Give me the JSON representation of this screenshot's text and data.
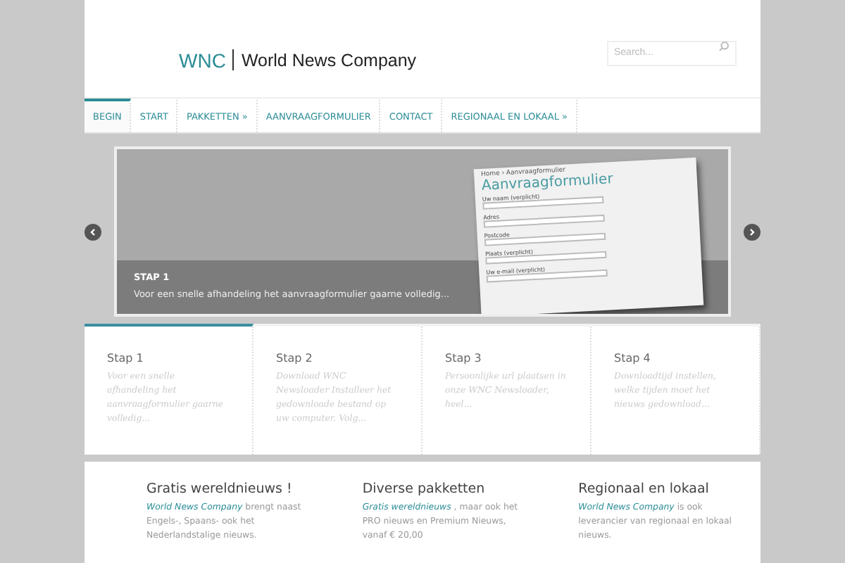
{
  "header": {
    "logo_short": "WNC",
    "logo_name": "World News Company",
    "search": {
      "placeholder": "Search..."
    }
  },
  "nav": [
    {
      "label": "BEGIN",
      "selected": true
    },
    {
      "label": "START",
      "selected": false
    },
    {
      "label": "PAKKETTEN »",
      "selected": false
    },
    {
      "label": "AANVRAAGFORMULIER",
      "selected": false
    },
    {
      "label": "CONTACT",
      "selected": false
    },
    {
      "label": "REGIONAAL EN LOKAAL »",
      "selected": false
    }
  ],
  "slider": {
    "form_image": {
      "breadcrumb": "Home › Aanvraagformulier",
      "title": "Aanvraagformulier",
      "fields": [
        "Uw naam (verplicht)",
        "Adres",
        "Postcode",
        "Plaats (verplicht)",
        "Uw e-mail (verplicht)"
      ]
    },
    "caption_title": "STAP 1",
    "caption_text": "Voor een snelle afhandeling het aanvraagformulier gaarne volledig..."
  },
  "steps": [
    {
      "title": "Stap 1",
      "text": "Voor een snelle afhandeling het aanvraagformulier gaarne volledig...",
      "selected": true
    },
    {
      "title": "Stap 2",
      "text": "Download WNC Newsloader Installeer het gedownloade bestand op uw computer. Volg...",
      "selected": false
    },
    {
      "title": "Stap 3",
      "text": "Persoonlijke url plaatsen in onze WNC Newsloader, heel...",
      "selected": false
    },
    {
      "title": "Stap 4",
      "text": "Downloadtijd instellen, welke tijden moet het nieuws gedownload...",
      "selected": false
    }
  ],
  "features": [
    {
      "title": "Gratis wereldnieuws !",
      "link": "World News Company",
      "text": "brengt naast Engels-, Spaans- ook het Nederlandstalige nieuws."
    },
    {
      "title": "Diverse pakketten",
      "link": "Gratis wereldnieuws",
      "text": ", maar ook het PRO nieuws en Premium Nieuws, vanaf € 20,00"
    },
    {
      "title": "Regionaal en lokaal",
      "link": "World News Company",
      "text": "is ook leverancier van regionaal en lokaal nieuws."
    }
  ]
}
